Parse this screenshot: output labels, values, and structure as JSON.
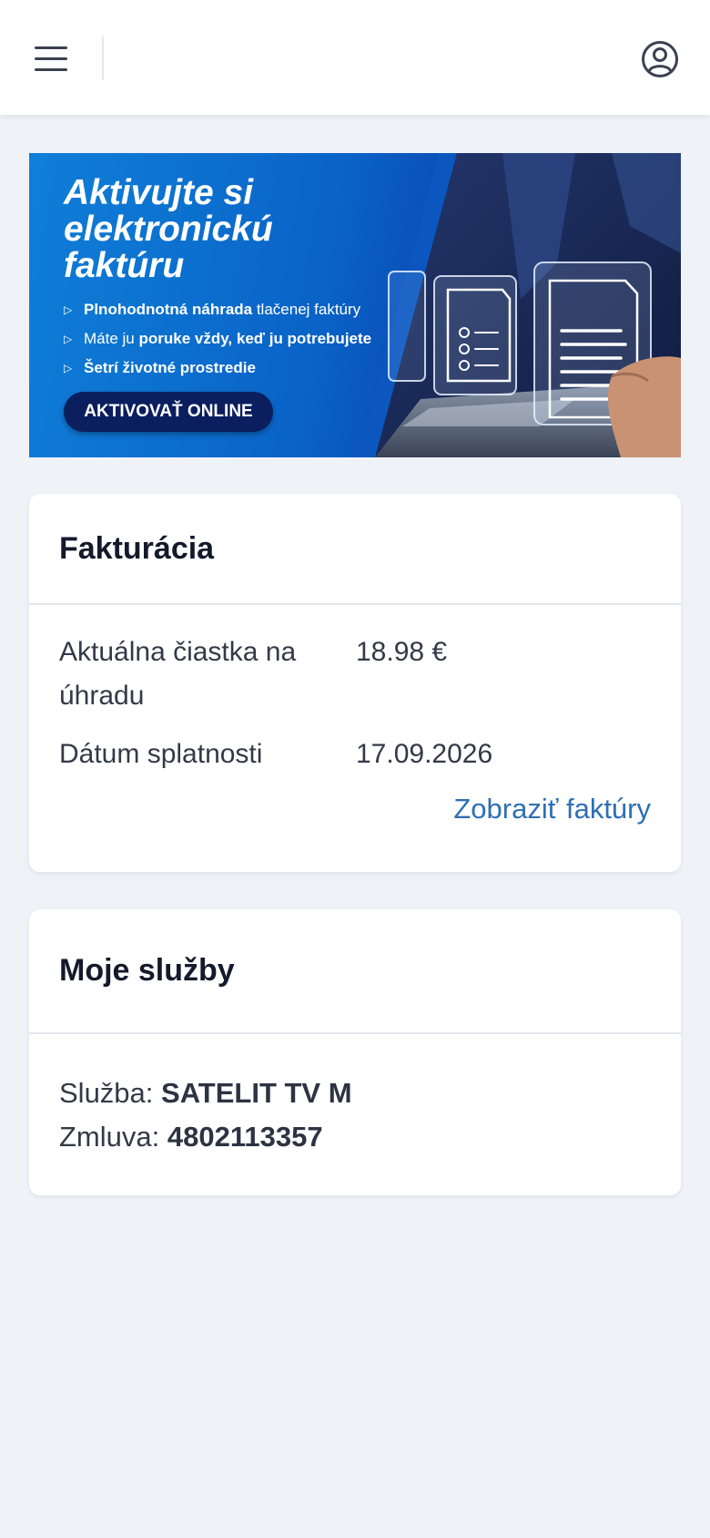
{
  "header": {
    "menu_icon": "hamburger-menu-icon",
    "account_icon": "user-circle-icon"
  },
  "banner": {
    "title_line1": "Aktivujte si",
    "title_line2": "elektronickú",
    "title_line3": "faktúru",
    "bullets": [
      {
        "bold": "Plnohodnotná náhrada",
        "rest": " tlačenej faktúry"
      },
      {
        "pre": "Máte ju ",
        "bold": "poruke vždy, keď ju potrebujete"
      },
      {
        "bold": "Šetrí životné prostredie"
      }
    ],
    "cta_label": "AKTIVOVAŤ ONLINE",
    "colors": {
      "blue": "#0a63c7",
      "cta": "#0b1e5e"
    }
  },
  "billing": {
    "title": "Fakturácia",
    "amount_label": "Aktuálna čiastka na úhradu",
    "amount_value": "18.98 €",
    "due_label": "Dátum splatnosti",
    "due_value": "17.09.2026",
    "invoices_link": "Zobraziť faktúry"
  },
  "services": {
    "title": "Moje služby",
    "service_label": "Služba: ",
    "service_value": "SATELIT TV M",
    "contract_label": "Zmluva: ",
    "contract_value": "4802113357"
  },
  "colors": {
    "background": "#eff2f7",
    "link": "#2e6fb3",
    "heading": "#141a2b"
  }
}
